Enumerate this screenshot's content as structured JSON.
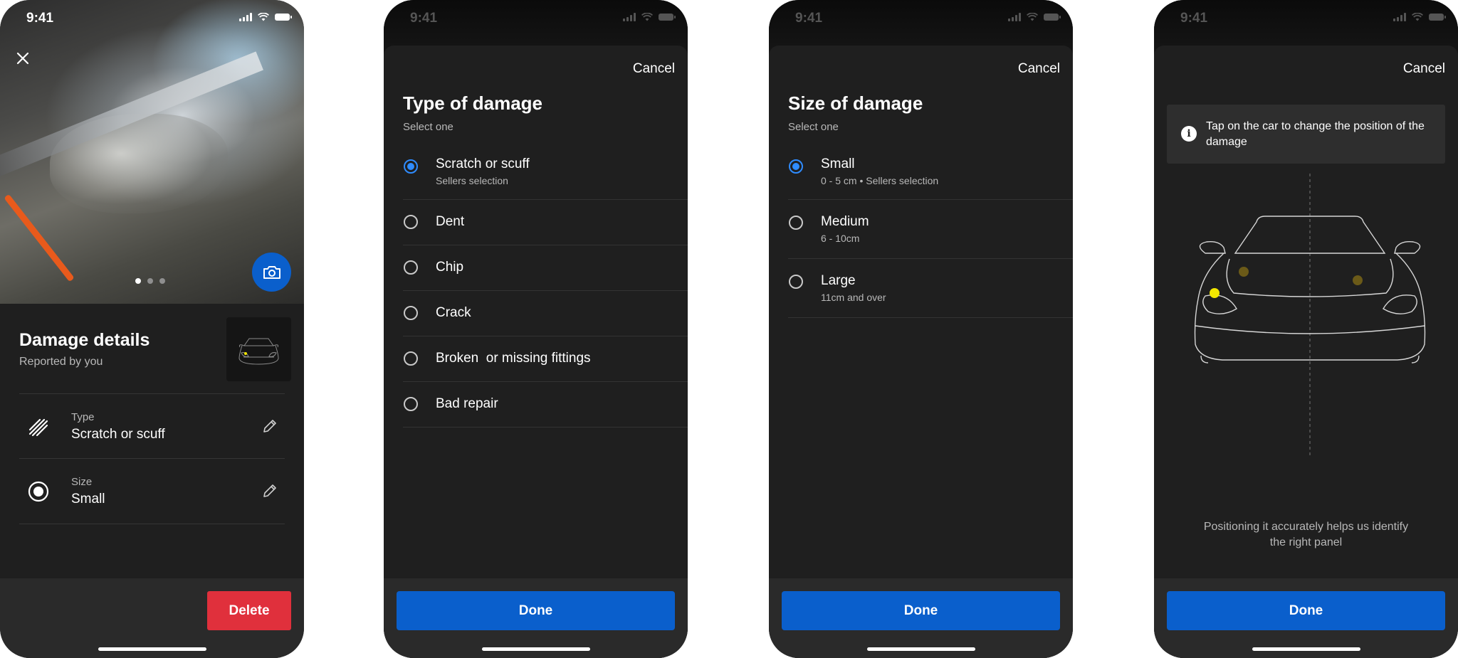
{
  "status_bar": {
    "time": "9:41"
  },
  "screen_damage_details": {
    "title": "Damage details",
    "subtitle": "Reported by you",
    "rows": [
      {
        "label": "Type",
        "value": "Scratch or scuff",
        "icon": "scratch-icon"
      },
      {
        "label": "Size",
        "value": "Small",
        "icon": "size-icon"
      }
    ],
    "photo_pager": {
      "count": 3,
      "active": 1
    },
    "delete_label": "Delete",
    "colors": {
      "delete": "#e0303c",
      "accent": "#0a5fcc"
    }
  },
  "screen_type": {
    "cancel_label": "Cancel",
    "title": "Type of damage",
    "subtitle": "Select one",
    "options": [
      {
        "label": "Scratch or scuff",
        "sub": "Sellers selection",
        "selected": true
      },
      {
        "label": "Dent",
        "sub": "",
        "selected": false
      },
      {
        "label": "Chip",
        "sub": "",
        "selected": false
      },
      {
        "label": "Crack",
        "sub": "",
        "selected": false
      },
      {
        "label": "Broken  or missing fittings",
        "sub": "",
        "selected": false
      },
      {
        "label": "Bad repair",
        "sub": "",
        "selected": false
      }
    ],
    "done_label": "Done"
  },
  "screen_size": {
    "cancel_label": "Cancel",
    "title": "Size of damage",
    "subtitle": "Select one",
    "options": [
      {
        "label": "Small",
        "sub": "0 - 5 cm • Sellers selection",
        "selected": true
      },
      {
        "label": "Medium",
        "sub": "6 - 10cm",
        "selected": false
      },
      {
        "label": "Large",
        "sub": "11cm and over",
        "selected": false
      }
    ],
    "done_label": "Done"
  },
  "screen_position": {
    "cancel_label": "Cancel",
    "info_text": "Tap on the car to change the position of the damage",
    "helper_text": "Positioning it accurately helps us identify the right panel",
    "done_label": "Done",
    "colors": {
      "marker_active": "#f2e600",
      "marker_inactive": "#6b5a18"
    }
  }
}
